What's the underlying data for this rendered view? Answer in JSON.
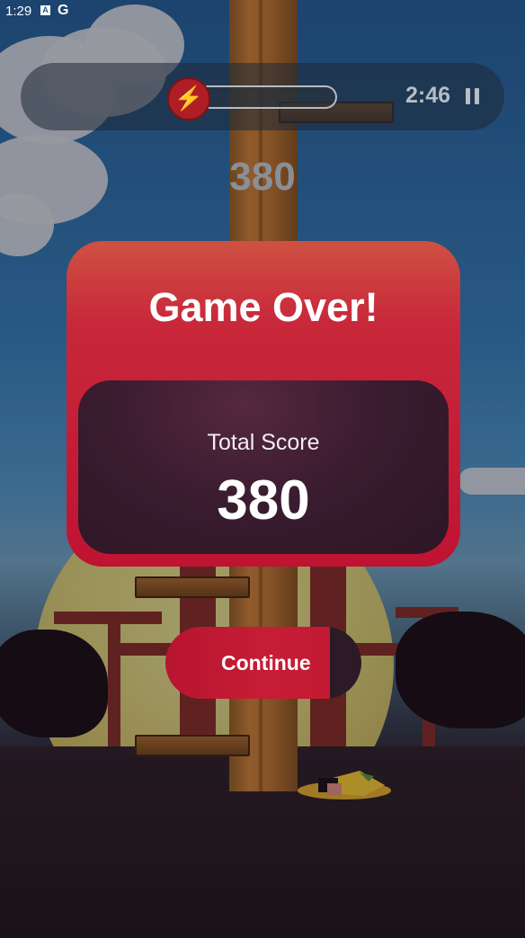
{
  "status_bar": {
    "time": "1:29",
    "app_icon_letter": "A",
    "google_letter": "G"
  },
  "hud": {
    "energy_icon": "lightning-bolt-icon",
    "energy_level": 0.0,
    "timer": "2:46",
    "pause_icon": "pause-icon"
  },
  "score_display": "380",
  "game_over": {
    "title": "Game Over!",
    "score_label": "Total Score",
    "score_value": "380",
    "continue_label": "Continue"
  },
  "colors": {
    "card_red": "#bf1332",
    "inner_panel": "#3b1c30",
    "hud_bg": "#1e2837",
    "energy_red": "#b01e25"
  }
}
